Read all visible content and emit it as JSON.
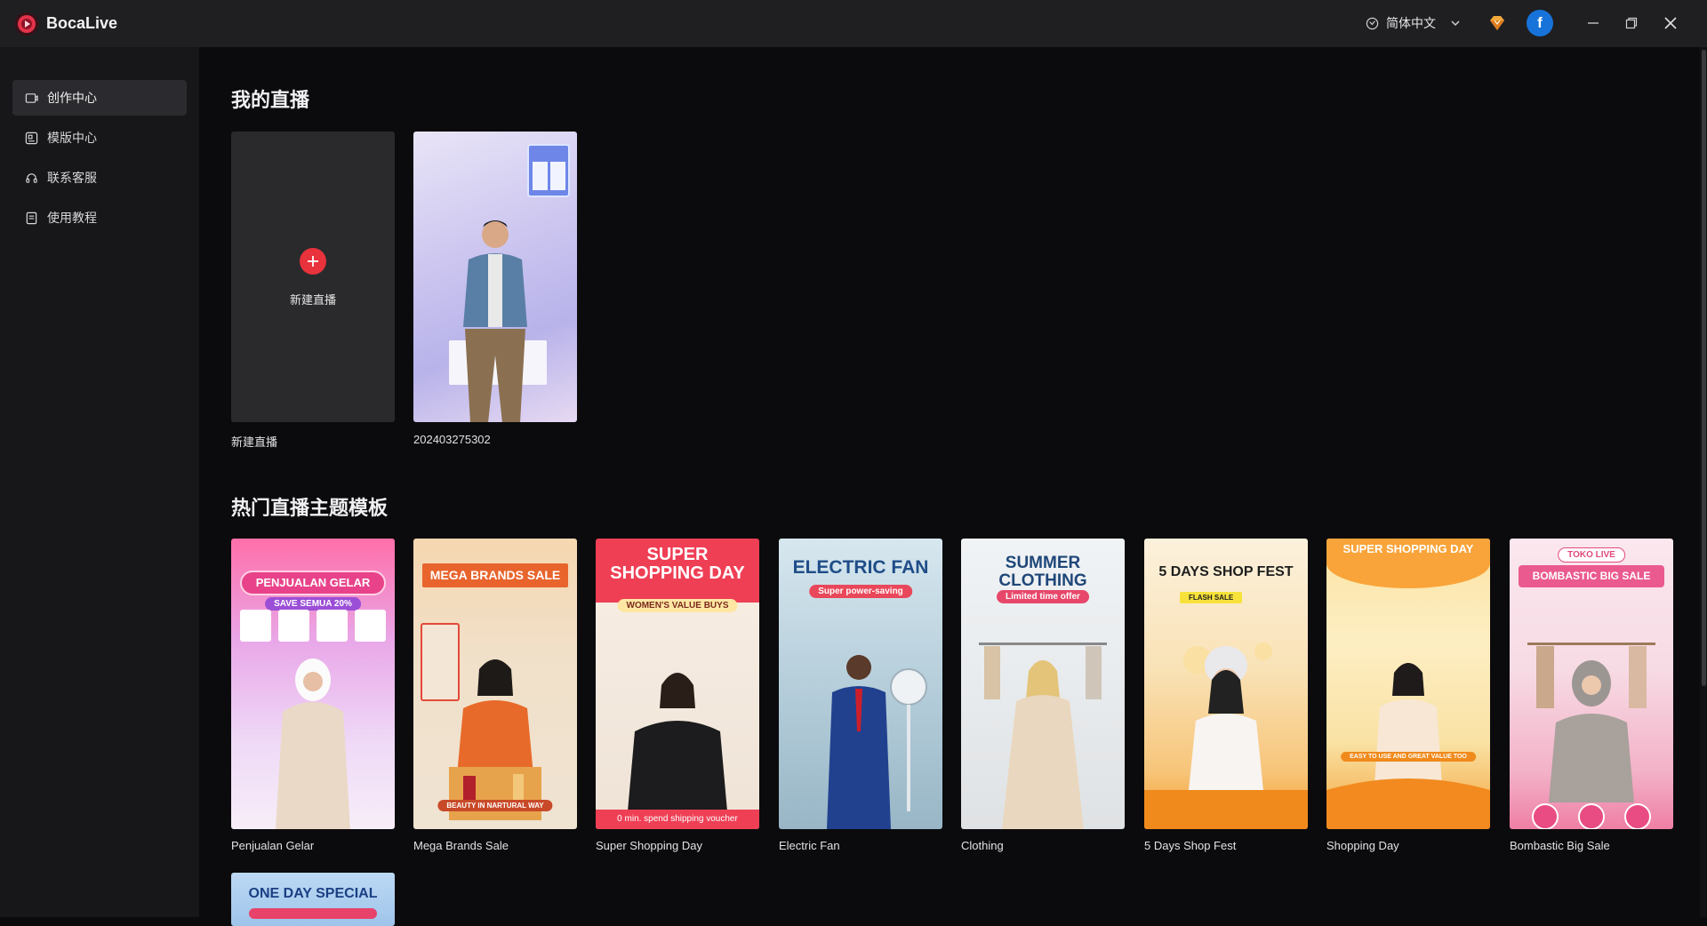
{
  "app": {
    "name": "BocaLive"
  },
  "titlebar": {
    "language": "简体中文",
    "avatar_letter": "f"
  },
  "sidebar": {
    "items": [
      {
        "label": "创作中心",
        "icon": "creation-icon",
        "active": true
      },
      {
        "label": "模版中心",
        "icon": "template-icon",
        "active": false
      },
      {
        "label": "联系客服",
        "icon": "headset-icon",
        "active": false
      },
      {
        "label": "使用教程",
        "icon": "tutorial-icon",
        "active": false
      }
    ]
  },
  "my_live": {
    "title": "我的直播",
    "new_card_text": "新建直播",
    "new_card_label": "新建直播",
    "items": [
      {
        "label": "202403275302"
      }
    ]
  },
  "templates": {
    "title": "热门直播主题模板",
    "items": [
      {
        "label": "Penjualan Gelar",
        "banner": "PENJUALAN GELAR",
        "sub": "SAVE SEMUA 20%"
      },
      {
        "label": "Mega Brands Sale",
        "banner": "MEGA BRANDS SALE",
        "sub": "BEAUTY IN NARTURAL WAY"
      },
      {
        "label": "Super Shopping Day",
        "banner": "SUPER SHOPPING DAY",
        "sub": "WOMEN'S VALUE BUYS",
        "footer": "0 min. spend shipping voucher"
      },
      {
        "label": "Electric Fan",
        "banner": "ELECTRIC FAN",
        "sub": "Super power-saving"
      },
      {
        "label": "Clothing",
        "banner": "SUMMER CLOTHING",
        "sub": "Limited time offer"
      },
      {
        "label": "5 Days Shop Fest",
        "banner": "5 DAYS SHOP FEST",
        "sub": "FLASH SALE"
      },
      {
        "label": "Shopping Day",
        "banner": "SUPER SHOPPING DAY",
        "sub": "EASY TO USE AND GREAT VALUE TOO"
      },
      {
        "label": "Bombastic Big Sale",
        "banner": "TOKO LIVE",
        "sub": "BOMBASTIC BIG SALE"
      }
    ],
    "partial": {
      "banner": "ONE DAY SPECIAL"
    }
  },
  "colors": {
    "accent": "#e8323c",
    "background": "#0b0b0d",
    "sidebar": "#17171a",
    "titlebar": "#1f1f22"
  }
}
